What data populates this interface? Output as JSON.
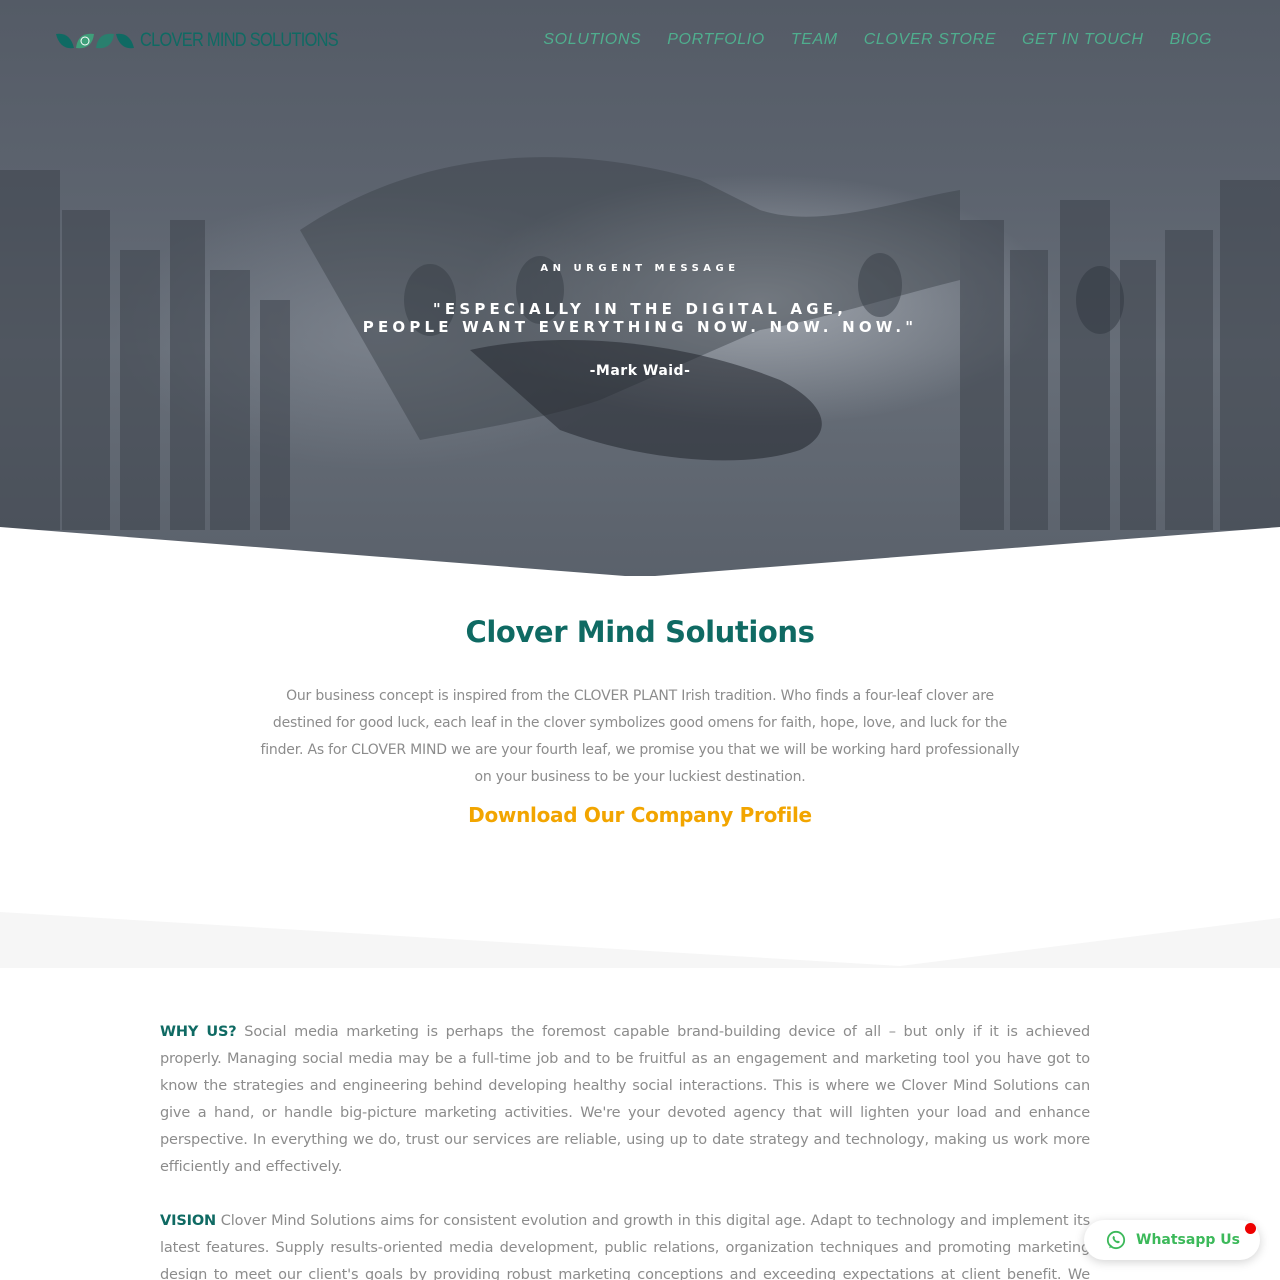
{
  "brand": {
    "name": "CLOVER MIND SOLUTIONS",
    "colors": {
      "teal": "#0f6a63",
      "nav_green": "#4fae8e",
      "accent_orange": "#f2a500",
      "whatsapp_green": "#3cb95a",
      "body_gray": "#8c8c8c"
    }
  },
  "nav": {
    "items": [
      {
        "label": "SOLUTIONS"
      },
      {
        "label": "PORTFOLIO"
      },
      {
        "label": "TEAM"
      },
      {
        "label": "CLOVER STORE"
      },
      {
        "label": "GET IN TOUCH"
      },
      {
        "label": "BIOG"
      }
    ]
  },
  "hero": {
    "eyebrow": "AN URGENT MESSAGE",
    "quote_line1": "\"ESPECIALLY IN THE DIGITAL AGE,",
    "quote_line2": "PEOPLE WANT EVERYTHING NOW. NOW. NOW.\"",
    "author": "-Mark Waid-"
  },
  "intro": {
    "title": "Clover Mind Solutions",
    "text": "Our business concept is inspired from the CLOVER PLANT Irish tradition. Who finds a four-leaf clover are destined for good luck, each leaf in the clover symbolizes good omens for faith, hope, love, and luck for the finder. As for CLOVER MIND we are your fourth leaf, we promise you that we will be working hard professionally on your business to be your luckiest destination.",
    "download_label": "Download Our Company Profile"
  },
  "why_us": {
    "lead": "WHY US?",
    "text": " Social media marketing is perhaps the foremost capable brand-building device of all – but only if it is achieved properly. Managing social media may be a full-time job and to be fruitful as an engagement and marketing tool you have got to know the strategies and engineering behind developing healthy social interactions. This is where we Clover Mind Solutions can give a hand, or handle big-picture marketing activities. We're your devoted agency that will lighten your load and enhance perspective. In everything we do, trust our services are reliable, using up to date strategy and technology, making us work more efficiently and effectively."
  },
  "vision": {
    "lead": "VISION",
    "text": " Clover Mind Solutions aims for consistent evolution and growth in this digital age. Adapt to technology and implement its latest features. Supply results-oriented media development, public relations, organization techniques and promoting marketing design to meet our client's goals by providing robust marketing conceptions and exceeding expectations at client benefit. We seek to become a"
  },
  "whatsapp": {
    "label": "Whatsapp Us",
    "icon": "whatsapp-icon"
  }
}
